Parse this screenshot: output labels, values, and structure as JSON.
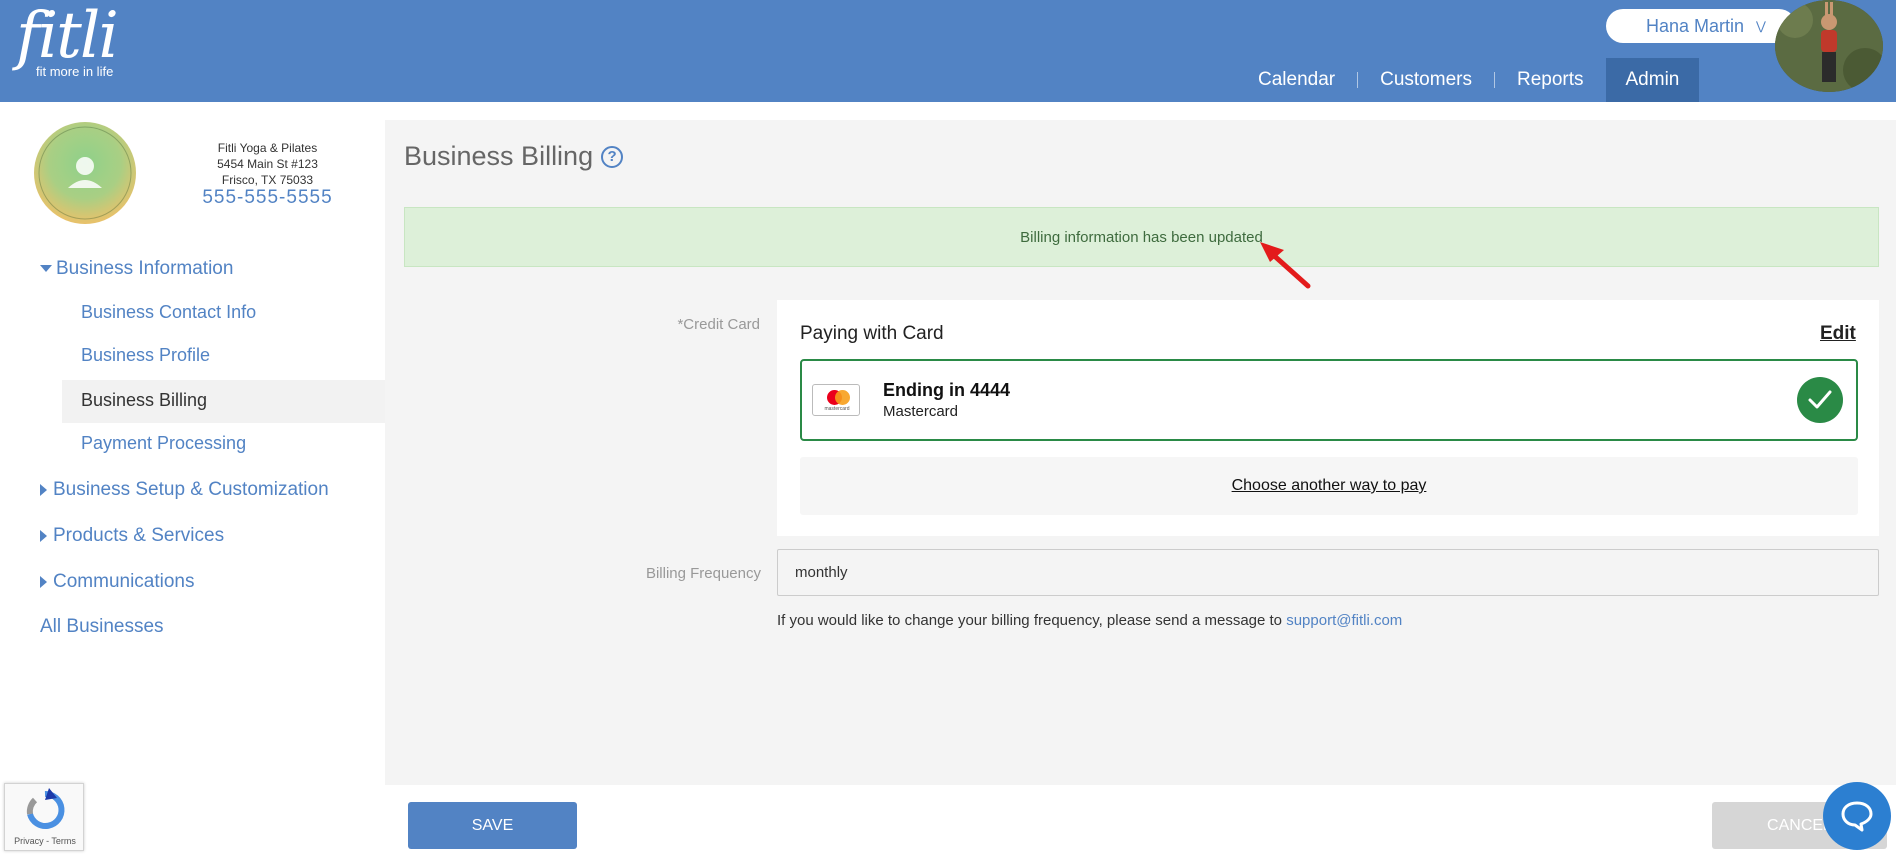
{
  "header": {
    "logo_word": "fitli",
    "logo_tagline": "fit more in life",
    "user_name": "Hana Martin",
    "nav": [
      "Calendar",
      "Customers",
      "Reports",
      "Admin"
    ],
    "active_nav": "Admin"
  },
  "business": {
    "name": "Fitli Yoga & Pilates",
    "address1": "5454 Main St #123",
    "address2": "Frisco, TX 75033",
    "phone": "555-555-5555"
  },
  "sidebar": {
    "section_business_info": "Business Information",
    "sub_contact": "Business Contact Info",
    "sub_profile": "Business Profile",
    "sub_billing": "Business Billing",
    "sub_payment": "Payment Processing",
    "section_setup": "Business Setup & Customization",
    "section_products": "Products & Services",
    "section_comms": "Communications",
    "all_businesses": "All Businesses"
  },
  "main": {
    "title": "Business Billing",
    "help_glyph": "?",
    "alert": "Billing information has been updated",
    "credit_card_label": "*Credit Card",
    "paying_with": "Paying with Card",
    "edit": "Edit",
    "card_ending": "Ending in 4444",
    "card_brand": "Mastercard",
    "card_logo_text": "mastercard",
    "choose_another": "Choose another way to pay",
    "billing_frequency_label": "Billing Frequency",
    "billing_frequency_value": "monthly",
    "freq_help_text": "If you would like to change your billing frequency, please send a message to ",
    "support_email": "support@fitli.com"
  },
  "footer": {
    "save": "SAVE",
    "cancel": "CANCEL",
    "recaptcha_text": "Privacy - Terms"
  },
  "colors": {
    "brand_blue": "#5283c4",
    "success_green": "#2a8a46",
    "alert_bg": "#ddf0d9"
  }
}
